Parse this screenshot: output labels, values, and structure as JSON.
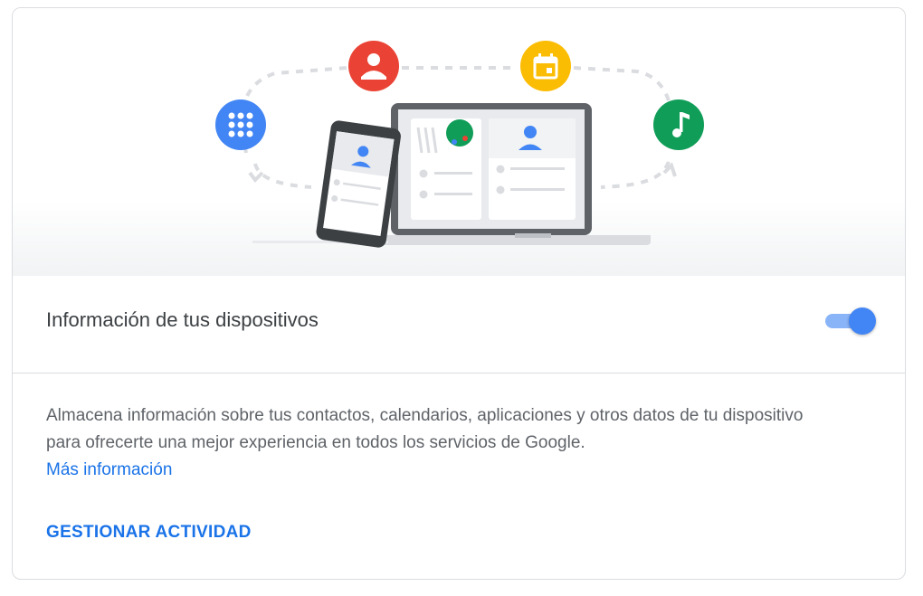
{
  "illustration": {
    "icons": [
      {
        "name": "apps-icon",
        "color": "#4285f4"
      },
      {
        "name": "contacts-icon",
        "color": "#ea4335"
      },
      {
        "name": "calendar-icon",
        "color": "#fbbc04"
      },
      {
        "name": "music-icon",
        "color": "#0f9d58"
      }
    ]
  },
  "setting": {
    "title": "Información de tus dispositivos",
    "enabled": true
  },
  "description": {
    "text": "Almacena información sobre tus contactos, calendarios, aplicaciones y otros datos de tu dispositivo para ofrecerte una mejor experiencia en todos los servicios de Google.",
    "link_label": "Más información"
  },
  "actions": {
    "manage_label": "GESTIONAR ACTIVIDAD"
  },
  "colors": {
    "accent": "#1a73e8",
    "toggle_track": "#8ab4f8",
    "toggle_thumb": "#4285f4"
  }
}
